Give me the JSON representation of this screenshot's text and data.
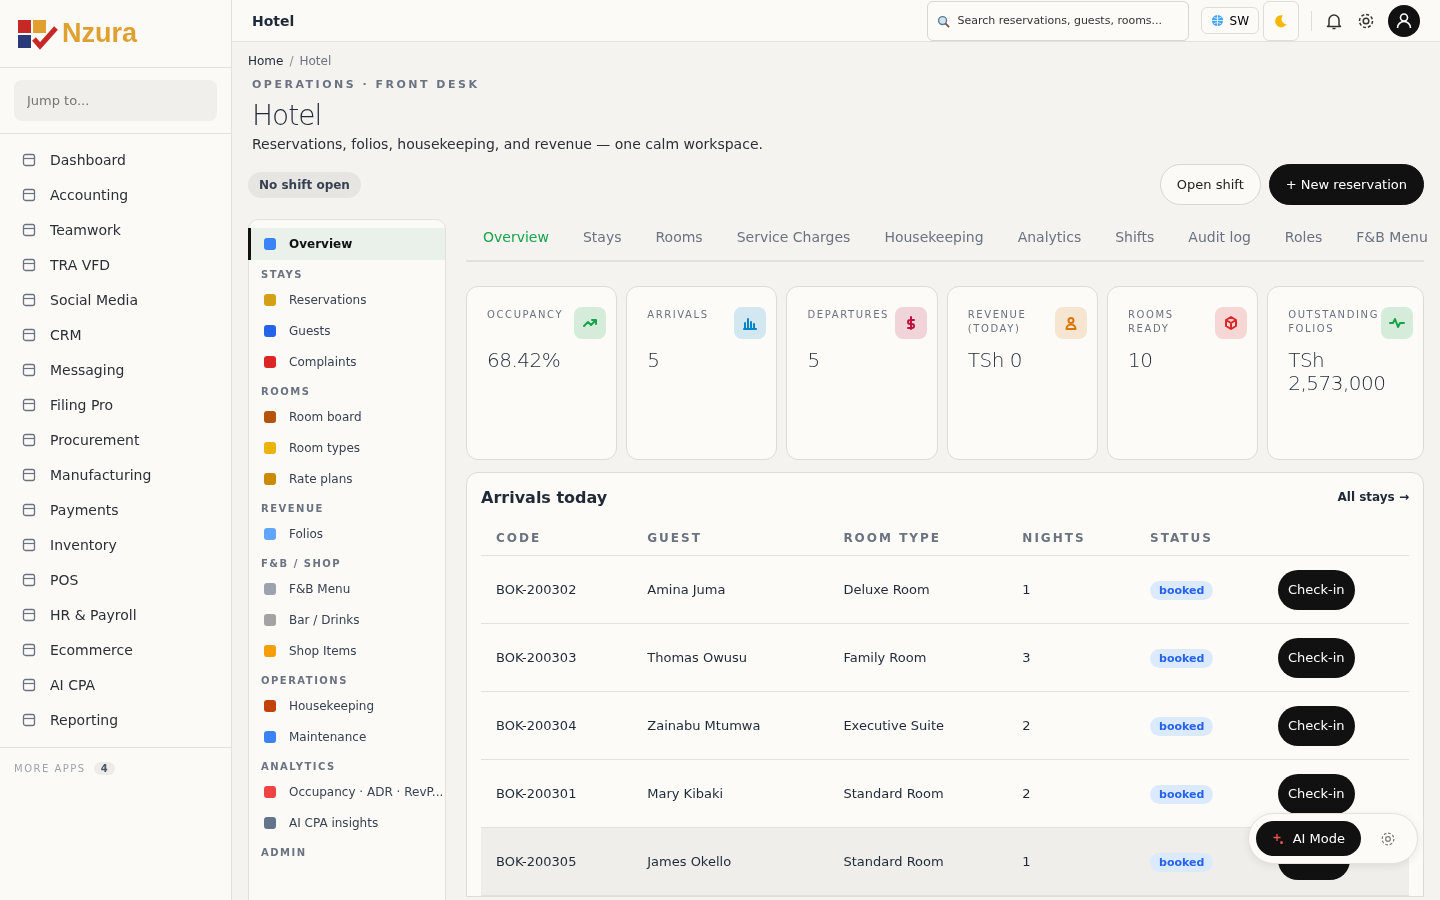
{
  "brand": {
    "name": "Nzura"
  },
  "topbar": {
    "title": "Hotel",
    "search": {
      "placeholder": "Search reservations, guests, rooms..."
    },
    "language": "SW"
  },
  "sidebar": {
    "search": {
      "placeholder": "Jump to..."
    },
    "items": [
      {
        "label": "Dashboard"
      },
      {
        "label": "Accounting"
      },
      {
        "label": "Teamwork"
      },
      {
        "label": "TRA VFD"
      },
      {
        "label": "Social Media"
      },
      {
        "label": "CRM"
      },
      {
        "label": "Messaging"
      },
      {
        "label": "Filing Pro"
      },
      {
        "label": "Procurement"
      },
      {
        "label": "Manufacturing"
      },
      {
        "label": "Payments"
      },
      {
        "label": "Inventory"
      },
      {
        "label": "POS"
      },
      {
        "label": "HR & Payroll"
      },
      {
        "label": "Ecommerce"
      },
      {
        "label": "AI CPA"
      },
      {
        "label": "Reporting"
      }
    ],
    "more_apps": {
      "label": "MORE APPS",
      "count": "4"
    }
  },
  "breadcrumb": [
    {
      "label": "Home"
    },
    {
      "label": "Hotel"
    }
  ],
  "breadcrumb_separator": "/",
  "header": {
    "eyebrow": "OPERATIONS · FRONT DESK",
    "title": "Hotel",
    "subtitle": "Reservations, folios, housekeeping, and revenue — one calm workspace.",
    "shift_status": "No shift open",
    "buttons": [
      {
        "label": "Open shift",
        "kind": "secondary"
      },
      {
        "label": "+ New reservation",
        "kind": "primary"
      }
    ]
  },
  "subnav": [
    {
      "kind": "item",
      "label": "Overview",
      "selected": true,
      "color": "#3b82f6"
    },
    {
      "kind": "section",
      "label": "STAYS"
    },
    {
      "kind": "item",
      "label": "Reservations",
      "selected": false,
      "color": "#d4a017"
    },
    {
      "kind": "item",
      "label": "Guests",
      "selected": false,
      "color": "#2563eb"
    },
    {
      "kind": "item",
      "label": "Complaints",
      "selected": false,
      "color": "#dc2626"
    },
    {
      "kind": "section",
      "label": "ROOMS"
    },
    {
      "kind": "item",
      "label": "Room board",
      "selected": false,
      "color": "#b45309"
    },
    {
      "kind": "item",
      "label": "Room types",
      "selected": false,
      "color": "#eab308"
    },
    {
      "kind": "item",
      "label": "Rate plans",
      "selected": false,
      "color": "#ca8a04"
    },
    {
      "kind": "section",
      "label": "REVENUE"
    },
    {
      "kind": "item",
      "label": "Folios",
      "selected": false,
      "color": "#60a5fa"
    },
    {
      "kind": "section",
      "label": "F&B / SHOP"
    },
    {
      "kind": "item",
      "label": "F&B Menu",
      "selected": false,
      "color": "#9ca3af"
    },
    {
      "kind": "item",
      "label": "Bar / Drinks",
      "selected": false,
      "color": "#a3a3a3"
    },
    {
      "kind": "item",
      "label": "Shop Items",
      "selected": false,
      "color": "#f59e0b"
    },
    {
      "kind": "section",
      "label": "OPERATIONS"
    },
    {
      "kind": "item",
      "label": "Housekeeping",
      "selected": false,
      "color": "#c2410c"
    },
    {
      "kind": "item",
      "label": "Maintenance",
      "selected": false,
      "color": "#3b82f6"
    },
    {
      "kind": "section",
      "label": "ANALYTICS"
    },
    {
      "kind": "item",
      "label": "Occupancy · ADR · RevP...",
      "selected": false,
      "color": "#ef4444"
    },
    {
      "kind": "item",
      "label": "AI CPA insights",
      "selected": false,
      "color": "#64748b"
    },
    {
      "kind": "section",
      "label": "ADMIN"
    }
  ],
  "tabs": [
    {
      "label": "Overview",
      "selected": true
    },
    {
      "label": "Stays",
      "selected": false
    },
    {
      "label": "Rooms",
      "selected": false
    },
    {
      "label": "Service Charges",
      "selected": false
    },
    {
      "label": "Housekeeping",
      "selected": false
    },
    {
      "label": "Analytics",
      "selected": false
    },
    {
      "label": "Shifts",
      "selected": false
    },
    {
      "label": "Audit log",
      "selected": false
    },
    {
      "label": "Roles",
      "selected": false
    },
    {
      "label": "F&B Menu",
      "selected": false
    }
  ],
  "kpis": [
    {
      "label": "OCCUPANCY",
      "value": "68.42%",
      "kind": "trend",
      "color": "#16a34a"
    },
    {
      "label": "ARRIVALS",
      "value": "5",
      "kind": "bars",
      "color": "#0284c7"
    },
    {
      "label": "DEPARTURES",
      "value": "5",
      "kind": "dollar",
      "color": "#be123c"
    },
    {
      "label": "REVENUE (TODAY)",
      "value": "TSh 0",
      "kind": "person",
      "color": "#d97706"
    },
    {
      "label": "ROOMS READY",
      "value": "10",
      "kind": "cube",
      "color": "#dc2626"
    },
    {
      "label": "OUTSTANDING FOLIOS",
      "value": "TSh 2,573,000",
      "kind": "pulse",
      "color": "#16a34a"
    }
  ],
  "arrivals": {
    "title": "Arrivals today",
    "link": "All stays →",
    "columns": [
      "CODE",
      "GUEST",
      "ROOM TYPE",
      "NIGHTS",
      "STATUS"
    ],
    "rows": [
      {
        "code": "BOK-200302",
        "guest": "Amina Juma",
        "room_type": "Deluxe Room",
        "nights": "1",
        "status": "booked",
        "action": "Check-in",
        "hovered": false
      },
      {
        "code": "BOK-200303",
        "guest": "Thomas Owusu",
        "room_type": "Family Room",
        "nights": "3",
        "status": "booked",
        "action": "Check-in",
        "hovered": false
      },
      {
        "code": "BOK-200304",
        "guest": "Zainabu Mtumwa",
        "room_type": "Executive Suite",
        "nights": "2",
        "status": "booked",
        "action": "Check-in",
        "hovered": false
      },
      {
        "code": "BOK-200301",
        "guest": "Mary Kibaki",
        "room_type": "Standard Room",
        "nights": "2",
        "status": "booked",
        "action": "Check-in",
        "hovered": false
      },
      {
        "code": "BOK-200305",
        "guest": "James Okello",
        "room_type": "Standard Room",
        "nights": "1",
        "status": "booked",
        "hovered": true
      }
    ]
  },
  "ai_mode": {
    "label": "AI Mode"
  }
}
